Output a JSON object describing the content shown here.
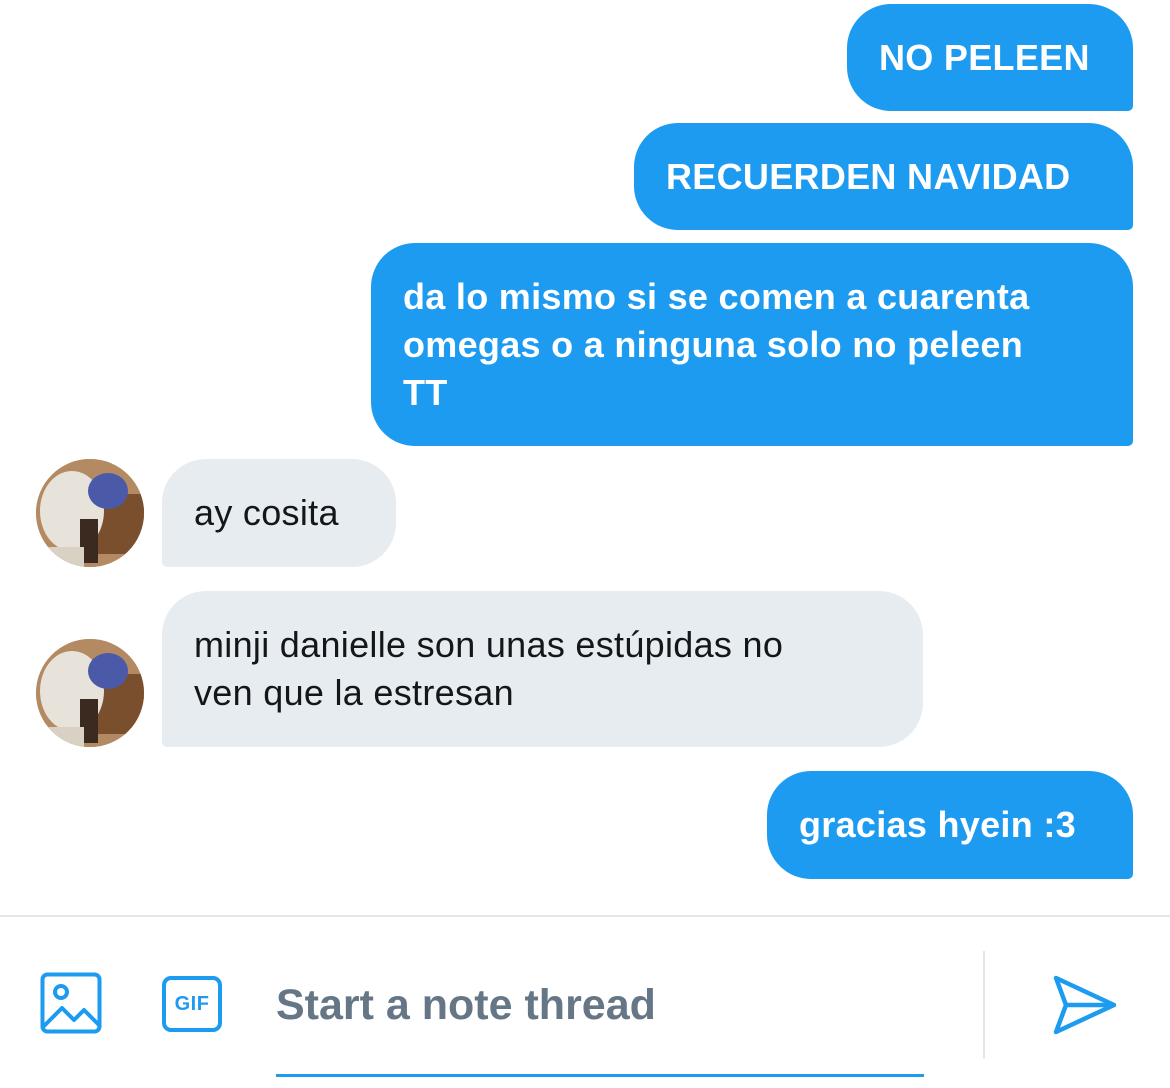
{
  "messages": [
    {
      "side": "outgoing",
      "text": "NO PELEEN"
    },
    {
      "side": "outgoing",
      "text": "RECUERDEN NAVIDAD"
    },
    {
      "side": "outgoing",
      "text": "da lo mismo si se comen a cuarenta\nomegas o a ninguna solo no peleen\nTT"
    },
    {
      "side": "incoming",
      "text": "ay cosita"
    },
    {
      "side": "incoming",
      "text": "minji danielle son unas estúpidas no\nven que la estresan"
    },
    {
      "side": "outgoing",
      "text": "gracias hyein :3"
    }
  ],
  "composer": {
    "placeholder": "Start a note thread",
    "value": "",
    "gif_label": "GIF",
    "image_icon": "image-icon",
    "send_icon": "send-icon"
  },
  "colors": {
    "accent": "#1d9bf0",
    "incoming_bubble": "#e7ecf0",
    "placeholder": "#657786",
    "divider": "#e1e8ed"
  }
}
